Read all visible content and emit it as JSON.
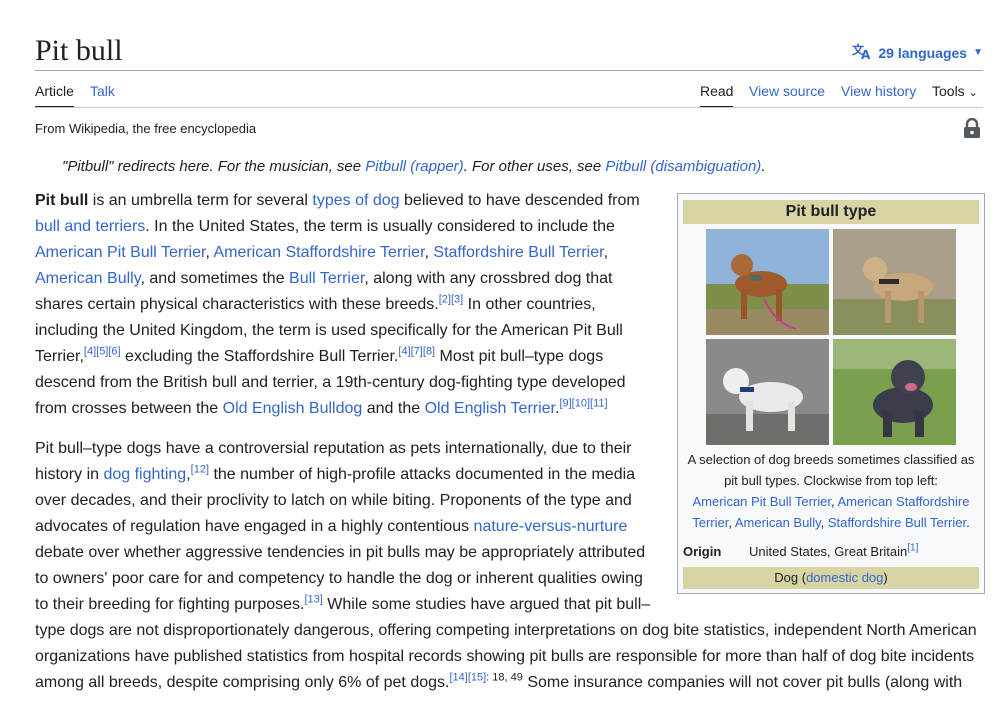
{
  "page": {
    "title": "Pit bull",
    "languages": "29 languages"
  },
  "tabs": {
    "article": "Article",
    "talk": "Talk",
    "read": "Read",
    "view_source": "View source",
    "view_history": "View history",
    "tools": "Tools"
  },
  "from_line": "From Wikipedia, the free encyclopedia",
  "hatnote": {
    "t1": "\"Pitbull\" redirects here. For the musician, see ",
    "l1": "Pitbull (rapper)",
    "t2": ". For other uses, see ",
    "l2": "Pitbull (disambiguation)",
    "t3": "."
  },
  "infobox": {
    "title": "Pit bull type",
    "caption_text": "A selection of dog breeds sometimes classified as pit bull types. Clockwise from top left:",
    "caption_links": [
      "American Pit Bull Terrier",
      "American Staffordshire Terrier",
      "American Bully",
      "Staffordshire Bull Terrier"
    ],
    "origin_label": "Origin",
    "origin_value": "United States, Great Britain",
    "origin_ref": "[1]",
    "footer_pre": "Dog (",
    "footer_link": "domestic dog",
    "footer_post": ")"
  },
  "p1": {
    "b": "Pit bull",
    "t1": " is an umbrella term for several ",
    "l1": "types of dog",
    "t2": " believed to have descended from ",
    "l2": "bull and terriers",
    "t3": ". In the United States, the term is usually considered to include the ",
    "l3": "American Pit Bull Terrier",
    "t4": ", ",
    "l4": "American Staffordshire Terrier",
    "t5": ", ",
    "l5": "Staffordshire Bull Terrier",
    "t6": ", ",
    "l6": "American Bully",
    "t7": ", and sometimes the ",
    "l7": "Bull Terrier",
    "t8": ", along with any crossbred dog that shares certain physical characteristics with these breeds.",
    "r1": "[2][3]",
    "t9": " In other countries, including the United Kingdom, the term is used specifically for the American Pit Bull Terrier,",
    "r2": "[4][5][6]",
    "t10": " excluding the Staffordshire Bull Terrier.",
    "r3": "[4][7][8]",
    "t11": " Most pit bull–type dogs descend from the British bull and terrier, a 19th-century dog-fighting type developed from crosses between the ",
    "l8": "Old English Bulldog",
    "t12": " and the ",
    "l9": "Old English Terrier",
    "t13": ".",
    "r4": "[9][10][11]"
  },
  "p2": {
    "t1": "Pit bull–type dogs have a controversial reputation as pets internationally, due to their history in ",
    "l1": "dog fighting",
    "t2": ",",
    "r1": "[12]",
    "t3": " the number of high-profile attacks documented in the media over decades, and their proclivity to latch on while biting. Proponents of the type and advocates of regulation have engaged in a highly contentious ",
    "l2": "nature-versus-nurture",
    "t4": " debate over whether aggressive tendencies in pit bulls may be appropriately attributed to owners' poor care for and competency to handle the dog or inherent qualities owing to their breeding for fighting purposes.",
    "r2": "[13]",
    "t5": " While some studies have argued that pit bull–type dogs are not disproportionately dangerous, offering competing interpretations on dog bite statistics, independent North American organizations have published statistics from hospital records showing pit bulls are responsible for more than half of dog bite incidents among all breeds, despite comprising only 6% of pet dogs.",
    "r3": "[14][15]",
    "r3b": ": 18, 49",
    "t6": " Some insurance companies will not cover pit bulls (along with"
  }
}
